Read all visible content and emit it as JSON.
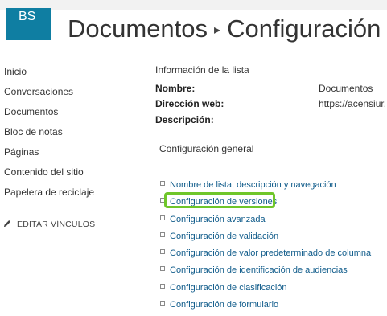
{
  "header": {
    "logo_text": "BS",
    "breadcrumb_parent": "Documentos",
    "breadcrumb_separator": "▸",
    "page_title": "Configuración",
    "logo_color": "#0f7ea2"
  },
  "leftnav": {
    "items": [
      {
        "label": "Inicio"
      },
      {
        "label": "Conversaciones"
      },
      {
        "label": "Documentos"
      },
      {
        "label": "Bloc de notas"
      },
      {
        "label": "Páginas"
      },
      {
        "label": "Contenido del sitio"
      },
      {
        "label": "Papelera de reciclaje"
      }
    ],
    "edit_links_label": "EDITAR VÍNCULOS",
    "edit_links_icon": "pencil-icon"
  },
  "list_info": {
    "title": "Información de la lista",
    "name_label": "Nombre:",
    "name_value": "Documentos",
    "url_label": "Dirección web:",
    "url_value": "https://acensiur.",
    "description_label": "Descripción:"
  },
  "general_settings": {
    "title": "Configuración general",
    "links": [
      {
        "label": "Nombre de lista, descripción y navegación"
      },
      {
        "label": "Configuración de versiones"
      },
      {
        "label": "Configuración avanzada"
      },
      {
        "label": "Configuración de validación"
      },
      {
        "label": "Configuración de valor predeterminado de columna"
      },
      {
        "label": "Configuración de identificación de audiencias"
      },
      {
        "label": "Configuración de clasificación"
      },
      {
        "label": "Configuración de formulario"
      }
    ],
    "link_color": "#0f5b8a",
    "highlight_color": "#6fc62a"
  }
}
